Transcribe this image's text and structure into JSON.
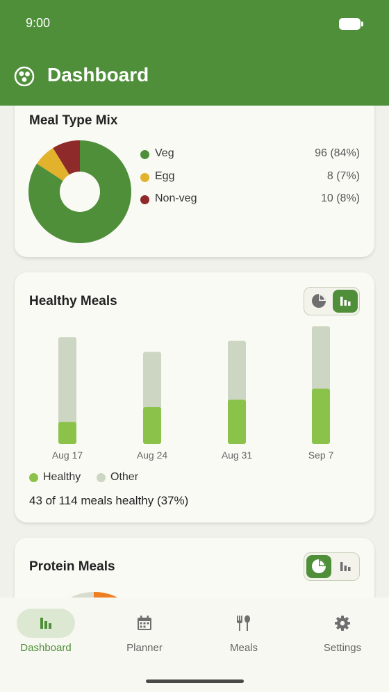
{
  "status_bar": {
    "time": "9:00"
  },
  "app_bar": {
    "title": "Dashboard",
    "logo_icon": "app-logo-icon"
  },
  "colors": {
    "primary": "#4f8f3a",
    "veg": "#4f8f3a",
    "egg": "#e2b22d",
    "nonveg": "#8e2a2a",
    "healthy": "#8bc34a",
    "other": "#cdd6c3",
    "protein": "#ef7d22"
  },
  "meal_mix": {
    "title": "Meal Type Mix",
    "items": [
      {
        "label": "Veg",
        "value": "96 (84%)",
        "count": 96
      },
      {
        "label": "Egg",
        "value": "8 (7%)",
        "count": 8
      },
      {
        "label": "Non-veg",
        "value": "10 (8%)",
        "count": 10
      }
    ]
  },
  "healthy_meals": {
    "title": "Healthy Meals",
    "toggle": {
      "pie_icon": "pie-chart-icon",
      "bar_icon": "bar-chart-icon",
      "active": "bar"
    },
    "legend": {
      "healthy": "Healthy",
      "other": "Other"
    },
    "summary": "43 of 114 meals healthy (37%)"
  },
  "protein_meals": {
    "title": "Protein Meals",
    "toggle": {
      "pie_icon": "pie-chart-icon",
      "bar_icon": "bar-chart-icon",
      "active": "pie"
    }
  },
  "chart_data": [
    {
      "type": "pie",
      "title": "Meal Type Mix",
      "categories": [
        "Veg",
        "Egg",
        "Non-veg"
      ],
      "values": [
        96,
        8,
        10
      ],
      "donut": true
    },
    {
      "type": "bar",
      "stacked": true,
      "title": "Healthy Meals",
      "categories": [
        "Aug 17",
        "Aug 24",
        "Aug 31",
        "Sep 7"
      ],
      "series": [
        {
          "name": "Healthy",
          "values": [
            6,
            10,
            12,
            15
          ]
        },
        {
          "name": "Other",
          "values": [
            23,
            15,
            16,
            17
          ]
        }
      ],
      "legend_position": "bottom-left",
      "grid": false
    }
  ],
  "nav": {
    "items": [
      {
        "label": "Dashboard",
        "icon": "bar-chart-icon",
        "active": true
      },
      {
        "label": "Planner",
        "icon": "calendar-icon",
        "active": false
      },
      {
        "label": "Meals",
        "icon": "fork-spoon-icon",
        "active": false
      },
      {
        "label": "Settings",
        "icon": "gear-icon",
        "active": false
      }
    ]
  }
}
